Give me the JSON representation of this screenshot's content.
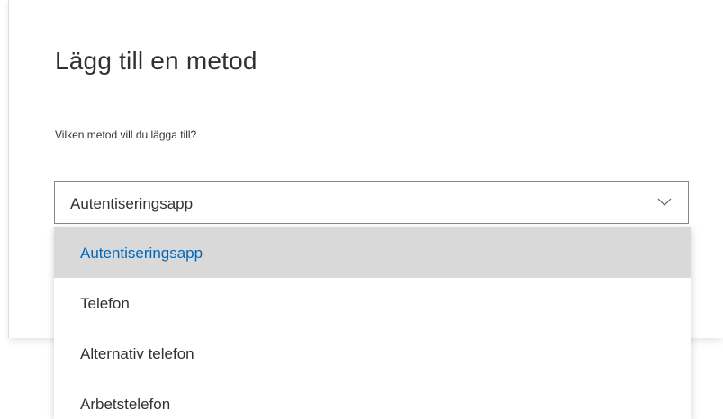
{
  "dialog": {
    "title": "Lägg till en metod",
    "prompt": "Vilken metod vill du lägga till?"
  },
  "method_select": {
    "selected_value": "Autentiseringsapp",
    "chevron_icon": "chevron-down-icon",
    "options": [
      {
        "label": "Autentiseringsapp",
        "highlighted": true
      },
      {
        "label": "Telefon",
        "highlighted": false
      },
      {
        "label": "Alternativ telefon",
        "highlighted": false
      },
      {
        "label": "Arbetstelefon",
        "highlighted": false
      }
    ]
  },
  "colors": {
    "highlight_text": "#0067b8",
    "highlight_background": "#d9d9d9",
    "text": "#323130",
    "border": "#8a8886"
  }
}
